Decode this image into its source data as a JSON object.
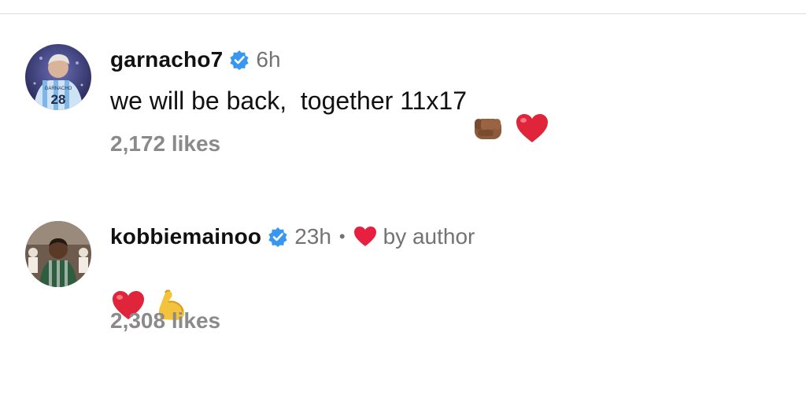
{
  "comments": [
    {
      "username": "garnacho7",
      "verified": true,
      "time": "6h",
      "text": "we will be back,  together 11x17",
      "emojis": [
        "fist-bump-icon",
        "red-heart-icon"
      ],
      "likes": "2,172 likes",
      "avatar": "avatar-photo-player-28",
      "jersey_text": "GARNACHO",
      "jersey_number": "28"
    },
    {
      "username": "kobbiemainoo",
      "verified": true,
      "time": "23h",
      "separator": "•",
      "liked_by_author": "by author",
      "text": "",
      "emojis": [
        "red-heart-icon",
        "flexed-biceps-icon"
      ],
      "likes": "2,308 likes",
      "avatar": "avatar-photo-player-green-kit"
    }
  ],
  "colors": {
    "username": "#111111",
    "secondary_text": "#737373",
    "likes_text": "#8a8a8a",
    "verified_badge": "#3897f0",
    "heart": "#e0245e",
    "divider": "#dcdcdc"
  }
}
